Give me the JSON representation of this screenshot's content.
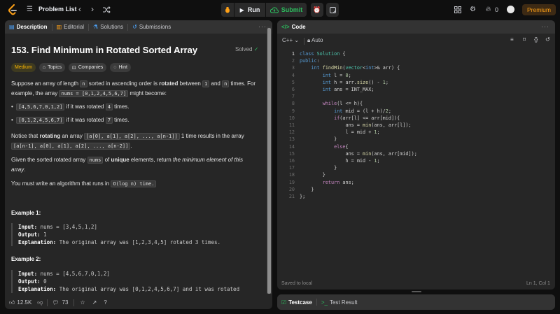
{
  "topbar": {
    "problem_list": "Problem List",
    "run": "Run",
    "submit": "Submit",
    "notif_count": "0",
    "premium": "Premium"
  },
  "desc_panel": {
    "tabs": [
      "Description",
      "Editorial",
      "Solutions",
      "Submissions"
    ]
  },
  "problem": {
    "title": "153. Find Minimum in Rotated Sorted Array",
    "status": "Solved",
    "tags": [
      "Medium",
      "Topics",
      "Companies",
      "Hint"
    ],
    "p1_a": "Suppose an array of length ",
    "p1_n": "n",
    "p1_b": " sorted in ascending order is ",
    "p1_rotated": "rotated",
    "p1_c": " between ",
    "p1_one": "1",
    "p1_and": " and ",
    "p1_n2": "n",
    "p1_d": " times. For",
    "p1_line2_a": "example, the array ",
    "p1_code": "nums = [0,1,2,4,5,6,7]",
    "p1_line2_b": " might become:",
    "bullets": [
      {
        "code": "[4,5,6,7,0,1,2]",
        "text": " if it was rotated ",
        "n": "4",
        "end": " times."
      },
      {
        "code": "[0,1,2,4,5,6,7]",
        "text": " if it was rotated ",
        "n": "7",
        "end": " times."
      }
    ],
    "p2_a": "Notice that ",
    "p2_bold": "rotating",
    "p2_b": " an array ",
    "p2_code1": "[a[0], a[1], a[2], ..., a[n-1]]",
    "p2_c": " 1 time results in the array",
    "p2_code2": "[a[n-1], a[0], a[1], a[2], ..., a[n-2]]",
    "p2_d": ".",
    "p3_a": "Given the sorted rotated array ",
    "p3_code": "nums",
    "p3_b": " of ",
    "p3_bold": "unique",
    "p3_c": " elements, return ",
    "p3_italic": "the minimum element of this",
    "p3_italic2": "array",
    "p3_d": ".",
    "p4_a": "You must write an algorithm that runs in ",
    "p4_code": "O(log n) time.",
    "examples": [
      {
        "title": "Example 1:",
        "input_label": "Input:",
        "input": " nums = [3,4,5,1,2]",
        "output_label": "Output:",
        "output": " 1",
        "expl_label": "Explanation:",
        "expl": " The original array was [1,2,3,4,5] rotated 3 times."
      },
      {
        "title": "Example 2:",
        "input_label": "Input:",
        "input": " nums = [4,5,6,7,0,1,2]",
        "output_label": "Output:",
        "output": " 0",
        "expl_label": "Explanation:",
        "expl": " The original array was [0,1,2,4,5,6,7] and it was rotated"
      }
    ]
  },
  "footer": {
    "likes": "12.5K",
    "comments": "73"
  },
  "code_panel": {
    "title": "Code",
    "language": "C++",
    "mode": "Auto",
    "saved": "Saved to local",
    "cursor": "Ln 1, Col 1"
  },
  "bottom_panel": {
    "tabs": [
      "Testcase",
      "Test Result"
    ]
  },
  "code_lines": [
    "class Solution {",
    "public:",
    "    int findMin(vector<int>& arr) {",
    "        int l = 0;",
    "        int h = arr.size() - 1;",
    "        int ans = INT_MAX;",
    "",
    "        while(l <= h){",
    "            int mid = (l + h)/2;",
    "            if(arr[l] <= arr[mid]){",
    "                ans = min(ans, arr[l]);",
    "                l = mid + 1;",
    "            }",
    "            else{",
    "                ans = min(ans, arr[mid]);",
    "                h = mid - 1;",
    "            }",
    "        }",
    "        return ans;",
    "    }",
    "};"
  ]
}
